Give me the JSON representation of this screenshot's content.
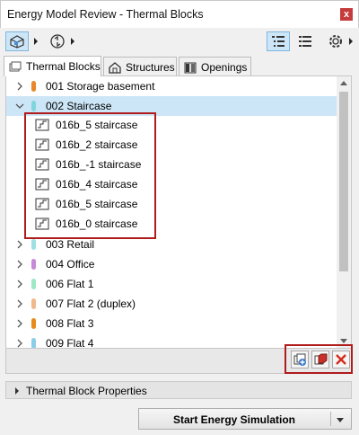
{
  "window": {
    "title": "Energy Model Review - Thermal Blocks",
    "close_glyph": "x"
  },
  "tabs": [
    {
      "label": "Thermal Blocks",
      "icon": "thermal-block-icon"
    },
    {
      "label": "Structures",
      "icon": "house-icon"
    },
    {
      "label": "Openings",
      "icon": "window-icon"
    }
  ],
  "tree": [
    {
      "label": "001 Storage basement",
      "color": "#e8882a",
      "expanded": false
    },
    {
      "label": "002 Staircase",
      "color": "#7fd6dc",
      "expanded": true,
      "selected": true,
      "children": [
        {
          "label": "016b_5 staircase"
        },
        {
          "label": "016b_2 staircase"
        },
        {
          "label": "016b_-1 staircase"
        },
        {
          "label": "016b_4 staircase"
        },
        {
          "label": "016b_5 staircase"
        },
        {
          "label": "016b_0 staircase"
        }
      ]
    },
    {
      "label": "003 Retail",
      "color": "#9fe0e2",
      "expanded": false
    },
    {
      "label": "004 Office",
      "color": "#c88ad8",
      "expanded": false
    },
    {
      "label": "006 Flat 1",
      "color": "#9fe8c4",
      "expanded": false
    },
    {
      "label": "007 Flat 2 (duplex)",
      "color": "#f0b98c",
      "expanded": false
    },
    {
      "label": "008 Flat 3",
      "color": "#e88a1a",
      "expanded": false
    },
    {
      "label": "009 Flat 4",
      "color": "#8ccde8",
      "expanded": false
    }
  ],
  "properties_label": "Thermal Block Properties",
  "start_button": "Start Energy Simulation",
  "colors": {
    "highlight": "#b01c1c",
    "selection": "#cde6f7",
    "delete": "#d42c1f"
  }
}
